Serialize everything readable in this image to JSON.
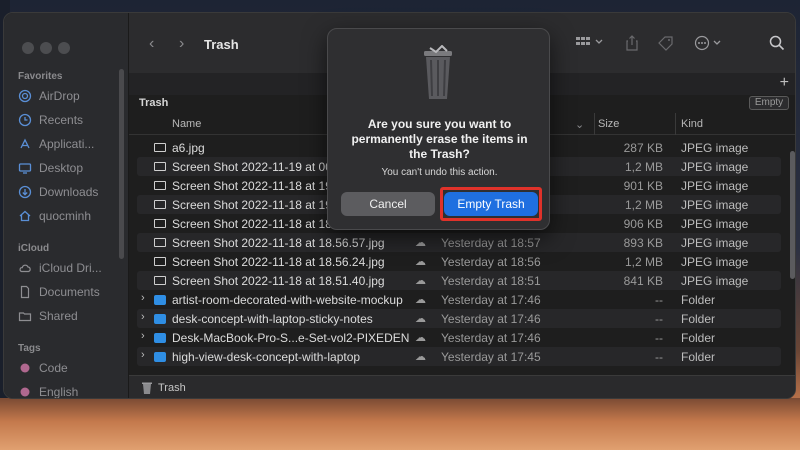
{
  "window": {
    "title": "Trash"
  },
  "sidebar": {
    "sections": [
      {
        "title": "Favorites",
        "items": [
          {
            "label": "AirDrop",
            "icon": "airdrop-icon"
          },
          {
            "label": "Recents",
            "icon": "clock-icon"
          },
          {
            "label": "Applicati...",
            "icon": "apps-icon"
          },
          {
            "label": "Desktop",
            "icon": "desktop-icon"
          },
          {
            "label": "Downloads",
            "icon": "download-icon"
          },
          {
            "label": "quocminh",
            "icon": "home-icon"
          }
        ]
      },
      {
        "title": "iCloud",
        "items": [
          {
            "label": "iCloud Dri...",
            "icon": "cloud-icon"
          },
          {
            "label": "Documents",
            "icon": "document-icon"
          },
          {
            "label": "Shared",
            "icon": "shared-folder-icon"
          }
        ]
      },
      {
        "title": "Tags",
        "items": [
          {
            "label": "Code",
            "color": "#b0688f"
          },
          {
            "label": "English",
            "color": "#b0688f"
          }
        ]
      }
    ]
  },
  "content": {
    "section_title": "Trash",
    "empty_button": "Empty",
    "columns": {
      "name": "Name",
      "size": "Size",
      "kind": "Kind"
    },
    "rows": [
      {
        "name": "a6.jpg",
        "date": "",
        "size": "287 KB",
        "kind": "JPEG image",
        "type": "file"
      },
      {
        "name": "Screen Shot 2022-11-19 at 00.",
        "date": "",
        "size": "1,2 MB",
        "kind": "JPEG image",
        "type": "file"
      },
      {
        "name": "Screen Shot 2022-11-18 at 19.",
        "date": "",
        "size": "901 KB",
        "kind": "JPEG image",
        "type": "file"
      },
      {
        "name": "Screen Shot 2022-11-18 at 19.",
        "date": "",
        "size": "1,2 MB",
        "kind": "JPEG image",
        "type": "file"
      },
      {
        "name": "Screen Shot 2022-11-18 at 18.",
        "date": "",
        "size": "906 KB",
        "kind": "JPEG image",
        "type": "file"
      },
      {
        "name": "Screen Shot 2022-11-18 at 18.56.57.jpg",
        "date": "Yesterday at 18:57",
        "size": "893 KB",
        "kind": "JPEG image",
        "type": "file"
      },
      {
        "name": "Screen Shot 2022-11-18 at 18.56.24.jpg",
        "date": "Yesterday at 18:56",
        "size": "1,2 MB",
        "kind": "JPEG image",
        "type": "file"
      },
      {
        "name": "Screen Shot 2022-11-18 at 18.51.40.jpg",
        "date": "Yesterday at 18:51",
        "size": "841 KB",
        "kind": "JPEG image",
        "type": "file"
      },
      {
        "name": "artist-room-decorated-with-website-mockup",
        "date": "Yesterday at 17:46",
        "size": "--",
        "kind": "Folder",
        "type": "folder"
      },
      {
        "name": "desk-concept-with-laptop-sticky-notes",
        "date": "Yesterday at 17:46",
        "size": "--",
        "kind": "Folder",
        "type": "folder"
      },
      {
        "name": "Desk-MacBook-Pro-S...e-Set-vol2-PIXEDEN",
        "date": "Yesterday at 17:46",
        "size": "--",
        "kind": "Folder",
        "type": "folder"
      },
      {
        "name": "high-view-desk-concept-with-laptop",
        "date": "Yesterday at 17:45",
        "size": "--",
        "kind": "Folder",
        "type": "folder"
      }
    ]
  },
  "statusbar": {
    "label": "Trash"
  },
  "dialog": {
    "title": "Are you sure you want to permanently erase the items in the Trash?",
    "message": "You can't undo this action.",
    "cancel": "Cancel",
    "confirm": "Empty Trash"
  },
  "colors": {
    "accent": "#1f6fe0",
    "highlight": "#e0322a",
    "folder": "#2f8ee4"
  }
}
